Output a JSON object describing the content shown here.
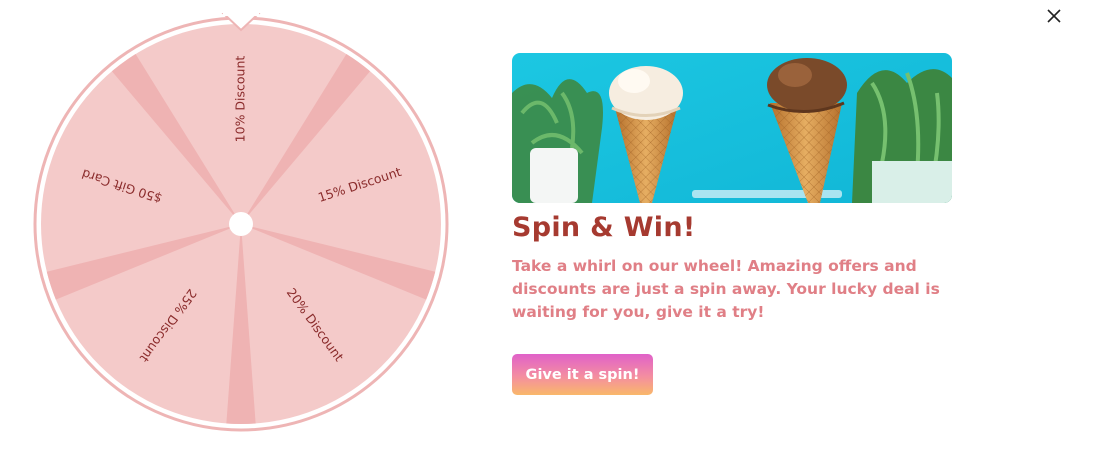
{
  "close": {
    "icon": "close-icon"
  },
  "wheel": {
    "segments": [
      {
        "label": "10% Discount"
      },
      {
        "label": "15% Discount"
      },
      {
        "label": "20% Discount"
      },
      {
        "label": "25% Discount"
      },
      {
        "label": "$50 Gift Card"
      }
    ],
    "colors": {
      "segment": "#f4cac9",
      "separator": "#efb3b3",
      "rim": "#eeb5b5",
      "label": "#8a2b2b",
      "hub": "#ffffff"
    }
  },
  "promo": {
    "image_alt": "Two ice cream cones on a blue background",
    "title": "Spin & Win!",
    "description": "Take a whirl on our wheel! Amazing offers and discounts are just a spin away. Your lucky deal is waiting for you, give it a try!",
    "button_label": "Give it a spin!"
  },
  "colors": {
    "title": "#a63a30",
    "description": "#e07f86",
    "button_gradient": [
      "#e061c9",
      "#f48ea0",
      "#f9b86a"
    ]
  }
}
